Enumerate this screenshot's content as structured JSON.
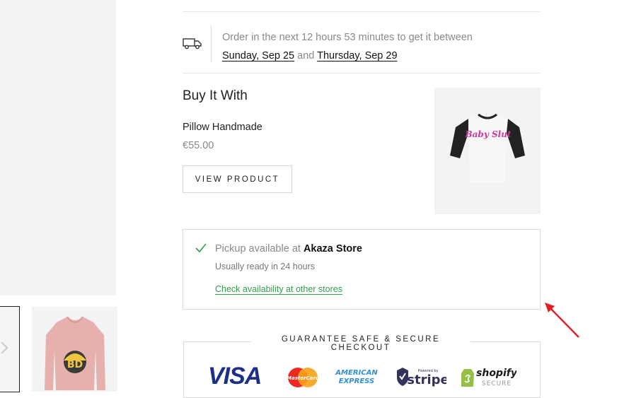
{
  "shipping": {
    "line1": "Order in the next 12 hours 53 minutes to get it between",
    "date_start": "Sunday, Sep 25",
    "connector": "and",
    "date_end": "Thursday, Sep 29",
    "icon": "delivery-truck-icon"
  },
  "bundle": {
    "title": "Buy It With",
    "product_name": "Pillow Handmade",
    "price": "€55.00",
    "button_label": "VIEW PRODUCT",
    "image_text": "Baby Slut"
  },
  "pickup": {
    "prefix": "Pickup available at",
    "store": "Akaza Store",
    "note": "Usually ready in 24 hours",
    "link": "Check availability at other stores",
    "icon": "check-icon",
    "link_color": "#2e9e4a"
  },
  "trust": {
    "title": "GUARANTEE SAFE & SECURE CHECKOUT",
    "payments": {
      "visa": "VISA",
      "mastercard": "MasterCard",
      "amex_line1": "AMERICAN",
      "amex_line2": "EXPRESS",
      "stripe_small": "Powered by",
      "stripe": "stripe",
      "shopify": "shopify",
      "shopify_sub": "SECURE"
    }
  },
  "thumbnail": {
    "logo_text": "BD"
  },
  "colors": {
    "annotation_arrow": "#e02020",
    "visa": "#1a2f8a"
  }
}
